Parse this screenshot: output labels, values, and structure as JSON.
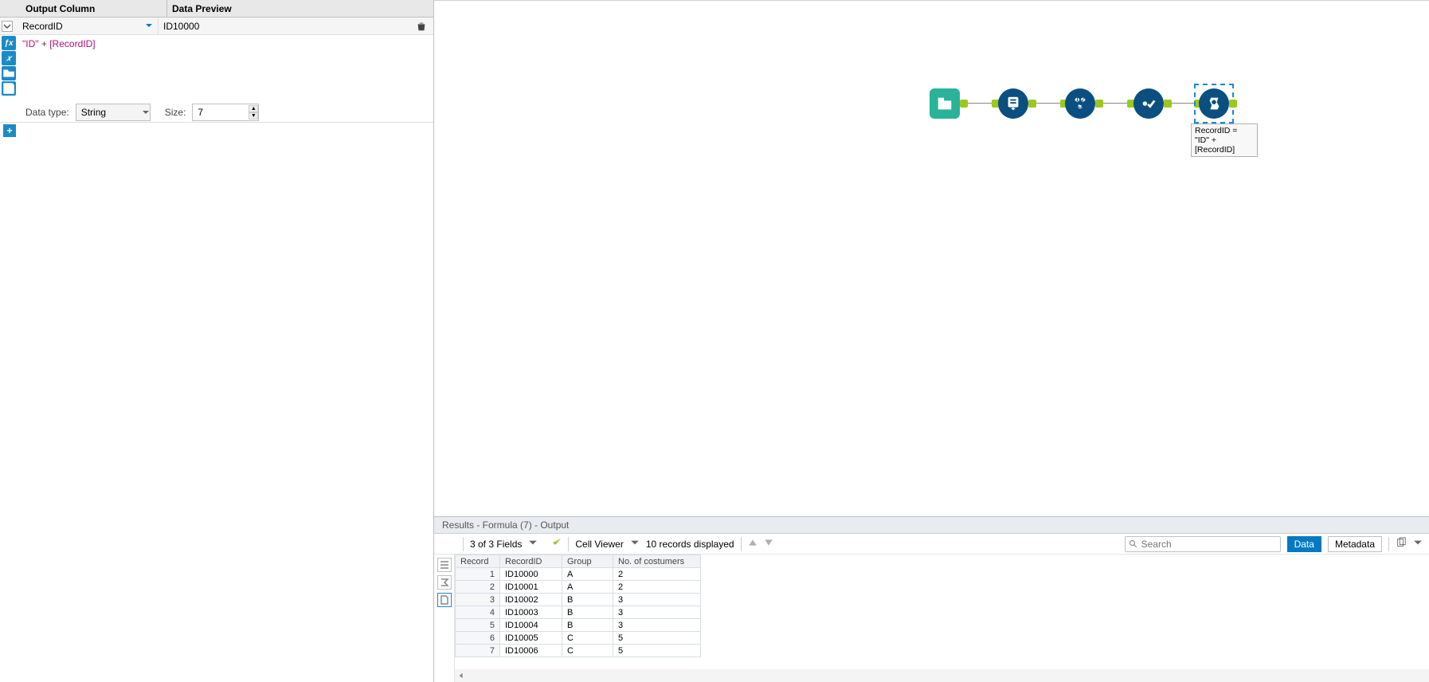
{
  "config": {
    "header_output_column": "Output Column",
    "header_data_preview": "Data Preview",
    "output_column_value": "RecordID",
    "data_preview_value": "ID10000",
    "expression": {
      "quote1": "\"ID\"",
      "plus": " + ",
      "field": "[RecordID]"
    },
    "data_type_label": "Data type:",
    "data_type_value": "String",
    "size_label": "Size:",
    "size_value": "7"
  },
  "canvas": {
    "node_label": "RecordID = \"ID\" + [RecordID]"
  },
  "results": {
    "title": "Results - Formula (7) - Output",
    "fields_summary": "3 of 3 Fields",
    "cell_viewer": "Cell Viewer",
    "record_count": "10 records displayed",
    "search_placeholder": "Search",
    "tab_data": "Data",
    "tab_metadata": "Metadata",
    "columns": [
      "Record",
      "RecordID",
      "Group",
      "No. of costumers"
    ],
    "rows": [
      {
        "rec": "1",
        "rid": "ID10000",
        "grp": "A",
        "n": "2"
      },
      {
        "rec": "2",
        "rid": "ID10001",
        "grp": "A",
        "n": "2"
      },
      {
        "rec": "3",
        "rid": "ID10002",
        "grp": "B",
        "n": "3"
      },
      {
        "rec": "4",
        "rid": "ID10003",
        "grp": "B",
        "n": "3"
      },
      {
        "rec": "5",
        "rid": "ID10004",
        "grp": "B",
        "n": "3"
      },
      {
        "rec": "6",
        "rid": "ID10005",
        "grp": "C",
        "n": "5"
      },
      {
        "rec": "7",
        "rid": "ID10006",
        "grp": "C",
        "n": "5"
      }
    ]
  }
}
